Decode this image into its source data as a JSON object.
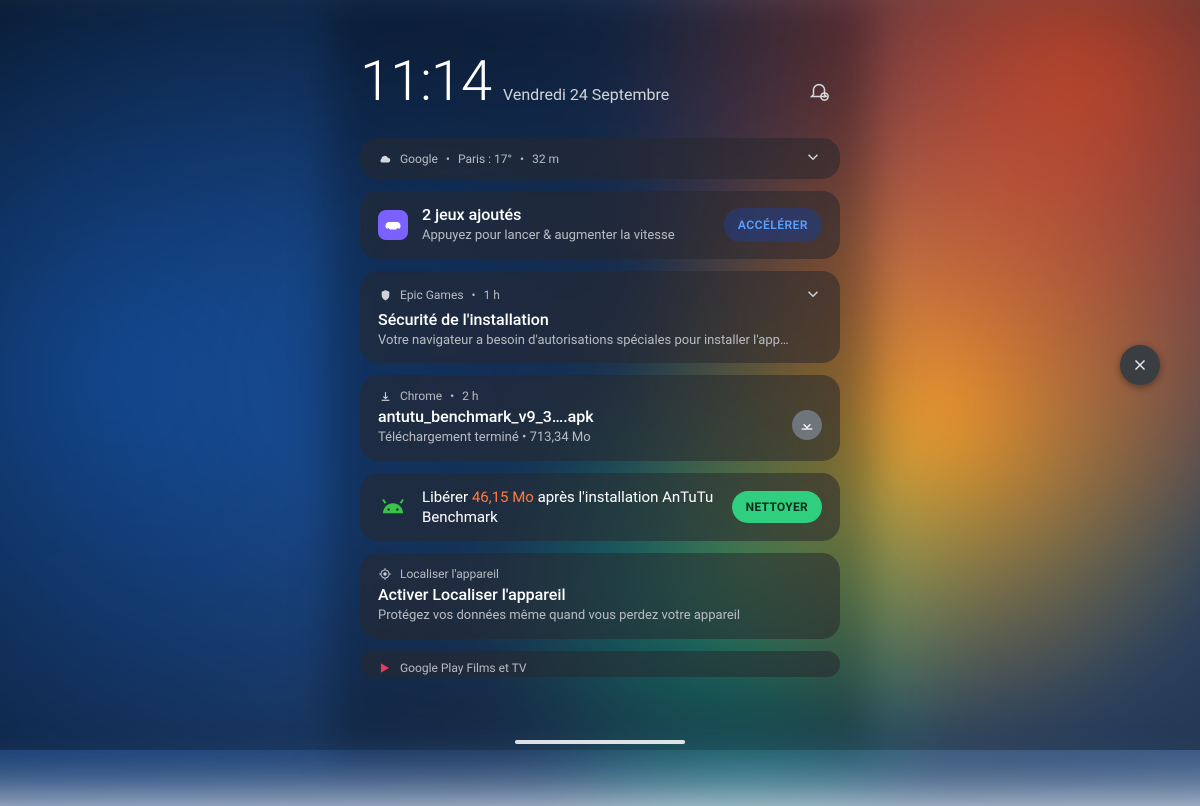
{
  "clock": {
    "time": "11:14",
    "date": "Vendredi 24 Septembre"
  },
  "weather": {
    "source": "Google",
    "location": "Paris",
    "temp": "17°",
    "age": "32 m"
  },
  "games": {
    "title": "2 jeux ajoutés",
    "body": "Appuyez pour lancer & augmenter la vitesse",
    "button": "ACCÉLÉRER"
  },
  "epic": {
    "app": "Epic Games",
    "age": "1 h",
    "title": "Sécurité de l'installation",
    "body": "Votre navigateur a besoin d'autorisations spéciales pour installer l'app…"
  },
  "chrome": {
    "app": "Chrome",
    "age": "2 h",
    "title": "antutu_benchmark_v9_3….apk",
    "body": "Téléchargement terminé • 713,34 Mo"
  },
  "cleaner": {
    "pre": "Libérer ",
    "highlight": "46,15 Mo",
    "post": " après l'installation AnTuTu Benchmark",
    "button": "NETTOYER"
  },
  "findmy": {
    "app": "Localiser l'appareil",
    "title": "Activer Localiser l'appareil",
    "body": "Protégez vos données même quand vous perdez votre appareil"
  },
  "playfilms": {
    "app": "Google Play Films et TV"
  }
}
